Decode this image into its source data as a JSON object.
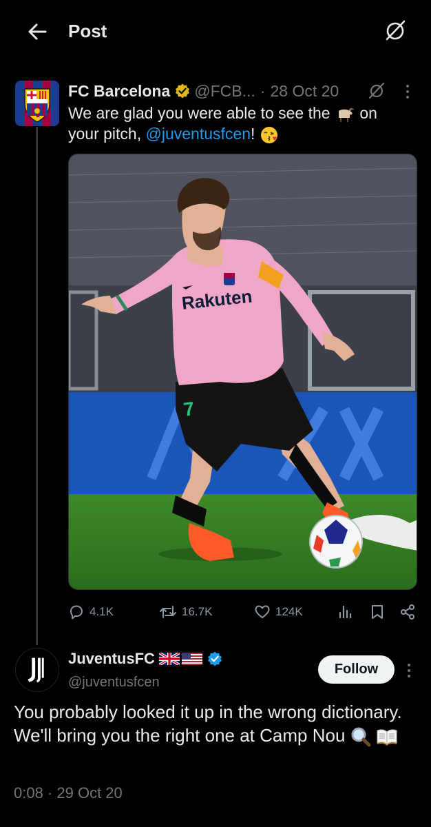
{
  "header": {
    "title": "Post"
  },
  "tweet1": {
    "name": "FC Barcelona",
    "handle": "@FCB...",
    "separator": "·",
    "date": "28 Oct 20",
    "text_before": "We are glad you were able to see the",
    "text_after": "on your pitch,",
    "mention": "@juventusfcen",
    "text_end": "!",
    "stats": {
      "replies": "4.1K",
      "reposts": "16.7K",
      "likes": "124K"
    }
  },
  "tweet2": {
    "name": "JuventusFC",
    "handle": "@juventusfcen",
    "follow_label": "Follow",
    "text": "You probably looked it up in the wrong dictionary. We'll bring you the right one at Camp Nou",
    "timestamp": "0:08 · 29 Oct 20"
  },
  "photo": {
    "jersey_text": "Rakuten",
    "number": "7"
  },
  "colors": {
    "background": "#000000",
    "text": "#e7e9ea",
    "muted": "#71767b",
    "link": "#1d9bf0",
    "verified_gold": "#e2b719",
    "verified_blue": "#1d9bf0"
  },
  "icons": [
    "back-arrow-icon",
    "grok-icon",
    "more-icon",
    "reply-icon",
    "repost-icon",
    "like-icon",
    "views-icon",
    "bookmark-icon",
    "share-icon",
    "goat-emoji",
    "kiss-emoji",
    "magnifier-emoji",
    "book-emoji"
  ]
}
